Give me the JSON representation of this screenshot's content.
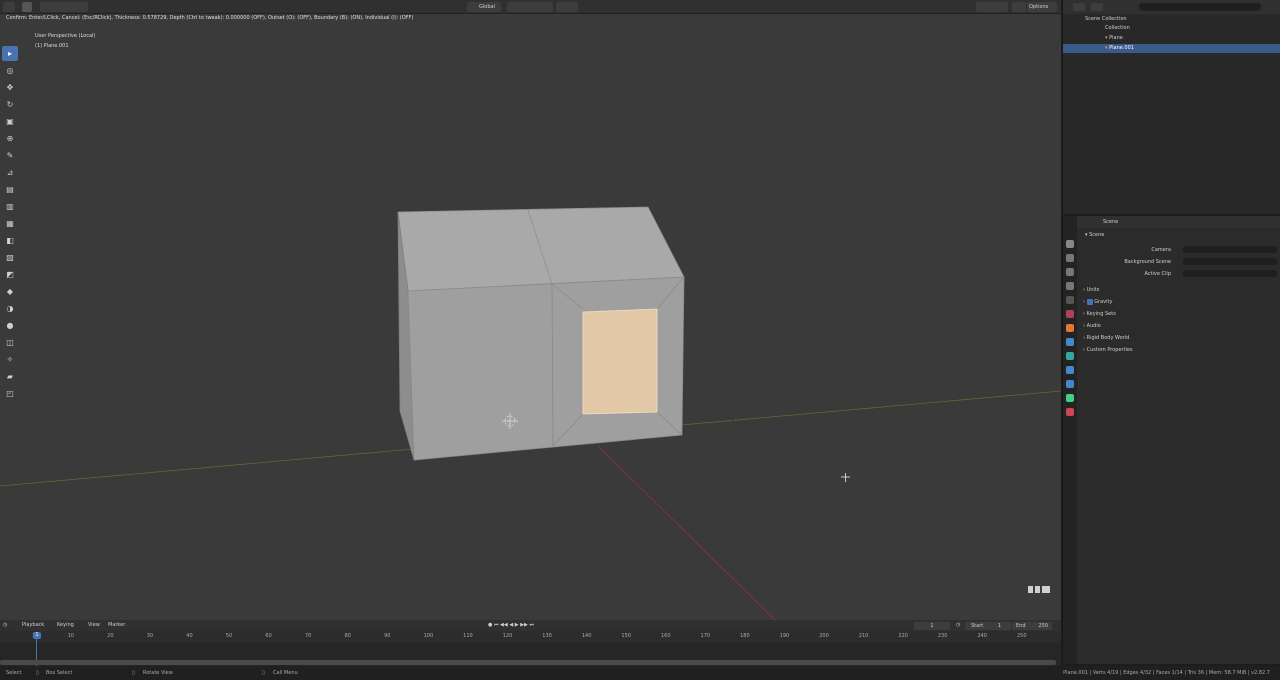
{
  "status_message": "Confirm: Enter/LClick, Cancel: (Esc/RClick), Thickness: 0.578729, Depth (Ctrl to tweak): 0.000000 (OFF), Outset (O): (OFF), Boundary (B): (ON), Individual (I): (OFF)",
  "header": {
    "orientation": "Global",
    "options": "Options"
  },
  "viewport": {
    "perspective": "User Perspective (Local)",
    "object": "(1) Plane.001"
  },
  "toolbar": {
    "tools": [
      "select-box",
      "cursor",
      "move",
      "rotate",
      "scale",
      "transform",
      "annotate",
      "measure",
      "add-cube",
      "extrude-region",
      "inset-faces",
      "bevel",
      "loop-cut",
      "knife",
      "poly-build",
      "spin",
      "smooth",
      "edge-slide",
      "shrink-fatten",
      "shear",
      "rip-region"
    ]
  },
  "outliner": {
    "items": [
      {
        "label": "Scene Collection",
        "indent": 0
      },
      {
        "label": "Collection",
        "indent": 1
      },
      {
        "label": "Plane",
        "indent": 2
      },
      {
        "label": "Plane.001",
        "indent": 2
      }
    ]
  },
  "properties": {
    "breadcrumb": "Scene",
    "section_title": "Scene",
    "fields": [
      {
        "label": "Camera"
      },
      {
        "label": "Background Scene"
      },
      {
        "label": "Active Clip"
      }
    ],
    "panels": [
      "Units",
      "Gravity",
      "Keying Sets",
      "Audio",
      "Rigid Body World",
      "Custom Properties"
    ],
    "gravity_checked": true
  },
  "timeline": {
    "menu": [
      "Playback",
      "Keying",
      "View",
      "Marker"
    ],
    "current_frame": "1",
    "start_label": "Start",
    "start_value": "1",
    "end_label": "End",
    "end_value": "250",
    "ticks": [
      "1",
      "10",
      "20",
      "30",
      "40",
      "50",
      "60",
      "70",
      "80",
      "90",
      "100",
      "110",
      "120",
      "130",
      "140",
      "150",
      "160",
      "170",
      "180",
      "190",
      "200",
      "210",
      "220",
      "230",
      "240",
      "250"
    ]
  },
  "statusbar": {
    "select": "Select",
    "box_select": "Box Select",
    "rotate_view": "Rotate View",
    "call_menu": "Call Menu",
    "stats": "Plane.001 | Verts 4/19 | Edges 4/32 | Faces 1/14 | Tris 36 | Mem: 58.7 MiB | v2.82.7"
  }
}
